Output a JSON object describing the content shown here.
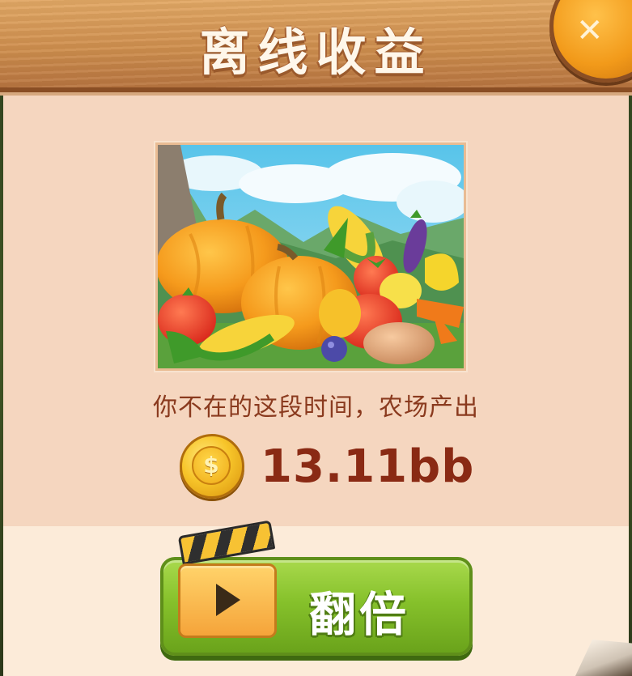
{
  "dialog": {
    "title": "离线收益",
    "close_icon_glyph": "✕",
    "description": "你不在的这段时间，农场产出",
    "reward": {
      "coin_symbol": "$",
      "value": "13.11bb"
    },
    "double_button": {
      "label": "翻倍",
      "icon": "video-clapper-icon"
    }
  },
  "colors": {
    "header_wood": "#cf8f4e",
    "panel_bg": "#f5d6bf",
    "text_brown": "#8a3a1e",
    "value_red": "#8a2a14",
    "button_green": "#86c12b",
    "coin_gold": "#f7c52a"
  }
}
